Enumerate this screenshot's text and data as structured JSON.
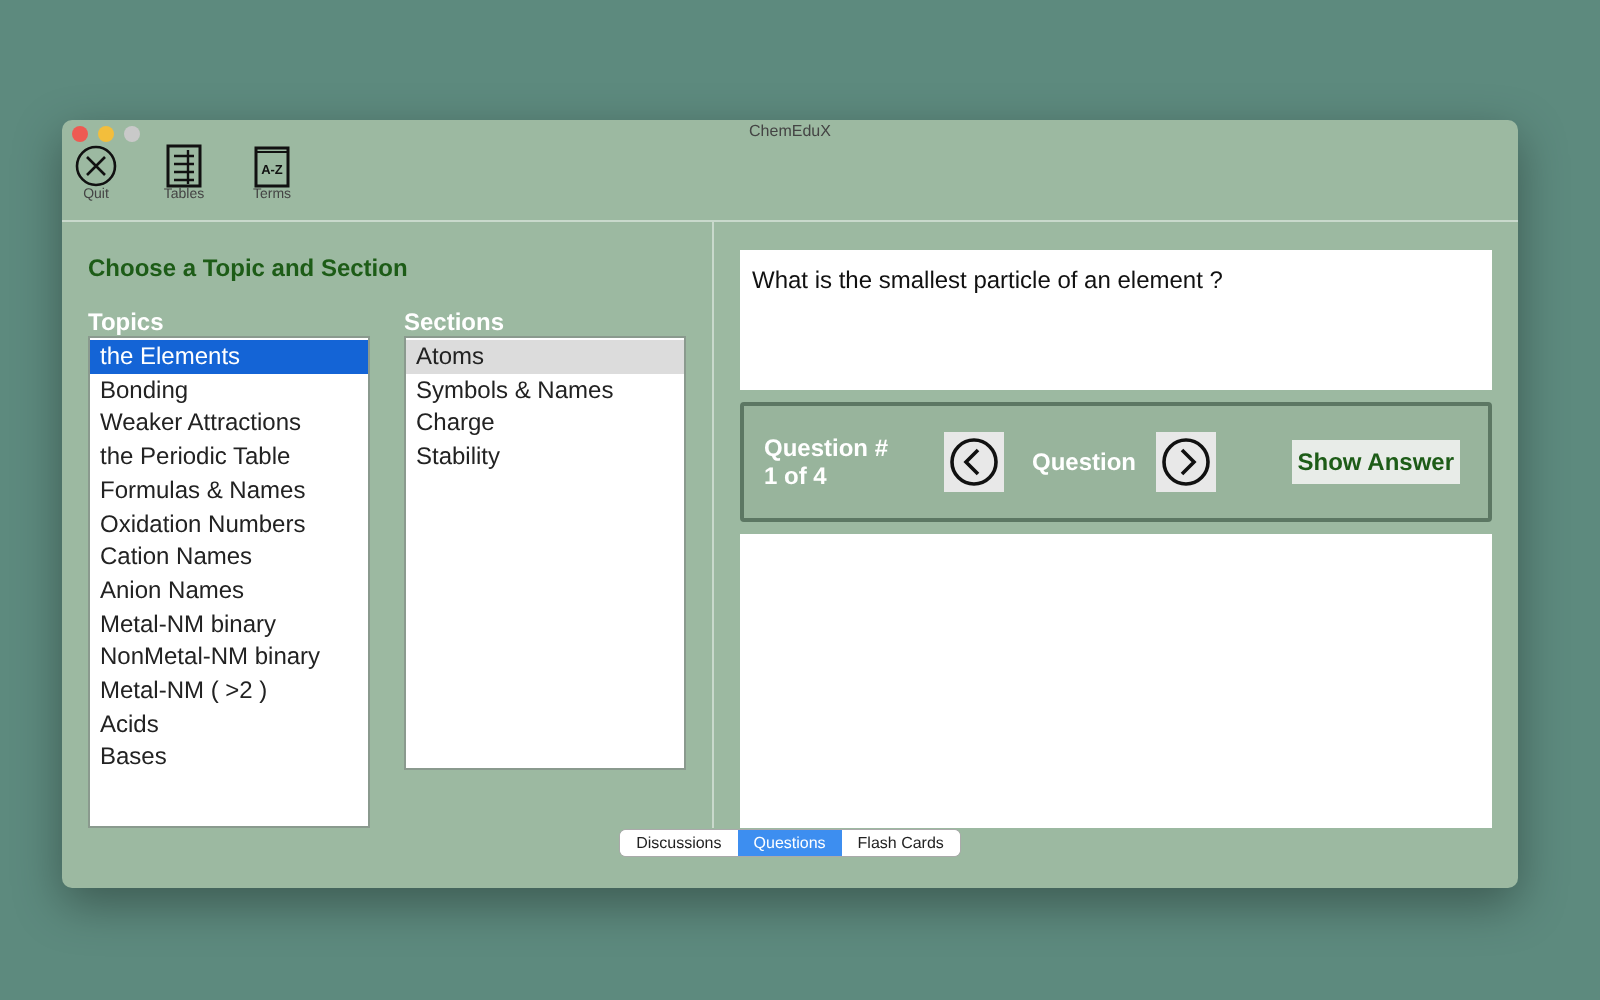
{
  "window": {
    "title": "ChemEduX"
  },
  "toolbar": [
    {
      "kind": "quit",
      "label": "Quit"
    },
    {
      "kind": "tables",
      "label": "Tables"
    },
    {
      "kind": "terms",
      "label": "Terms",
      "icon_text": "A-Z"
    }
  ],
  "heading": "Choose a Topic and Section",
  "topics": {
    "title": "Topics",
    "items": [
      {
        "label": "the Elements",
        "selected": true
      },
      {
        "label": "Bonding",
        "selected": false
      },
      {
        "label": "Weaker Attractions",
        "selected": false
      },
      {
        "label": "the Periodic Table",
        "selected": false
      },
      {
        "label": "Formulas & Names",
        "selected": false
      },
      {
        "label": "Oxidation Numbers",
        "selected": false
      },
      {
        "label": "Cation Names",
        "selected": false
      },
      {
        "label": "Anion Names",
        "selected": false
      },
      {
        "label": "Metal-NM binary",
        "selected": false
      },
      {
        "label": "NonMetal-NM binary",
        "selected": false
      },
      {
        "label": "Metal-NM ( >2 )",
        "selected": false
      },
      {
        "label": "Acids",
        "selected": false
      },
      {
        "label": "Bases",
        "selected": false
      }
    ]
  },
  "sections": {
    "title": "Sections",
    "items": [
      {
        "label": "Atoms",
        "selected": true
      },
      {
        "label": "Symbols & Names",
        "selected": false
      },
      {
        "label": "Charge",
        "selected": false
      },
      {
        "label": "Stability",
        "selected": false
      }
    ]
  },
  "question": {
    "text": "What is the smallest particle of an element ?"
  },
  "controls": {
    "counter_title": "Question #",
    "counter": "1 of 4",
    "nav_label": "Question",
    "show_answer": "Show Answer"
  },
  "bottom_tabs": [
    {
      "label": "Discussions",
      "selected": false
    },
    {
      "label": "Questions",
      "selected": true
    },
    {
      "label": "Flash Cards",
      "selected": false
    }
  ]
}
